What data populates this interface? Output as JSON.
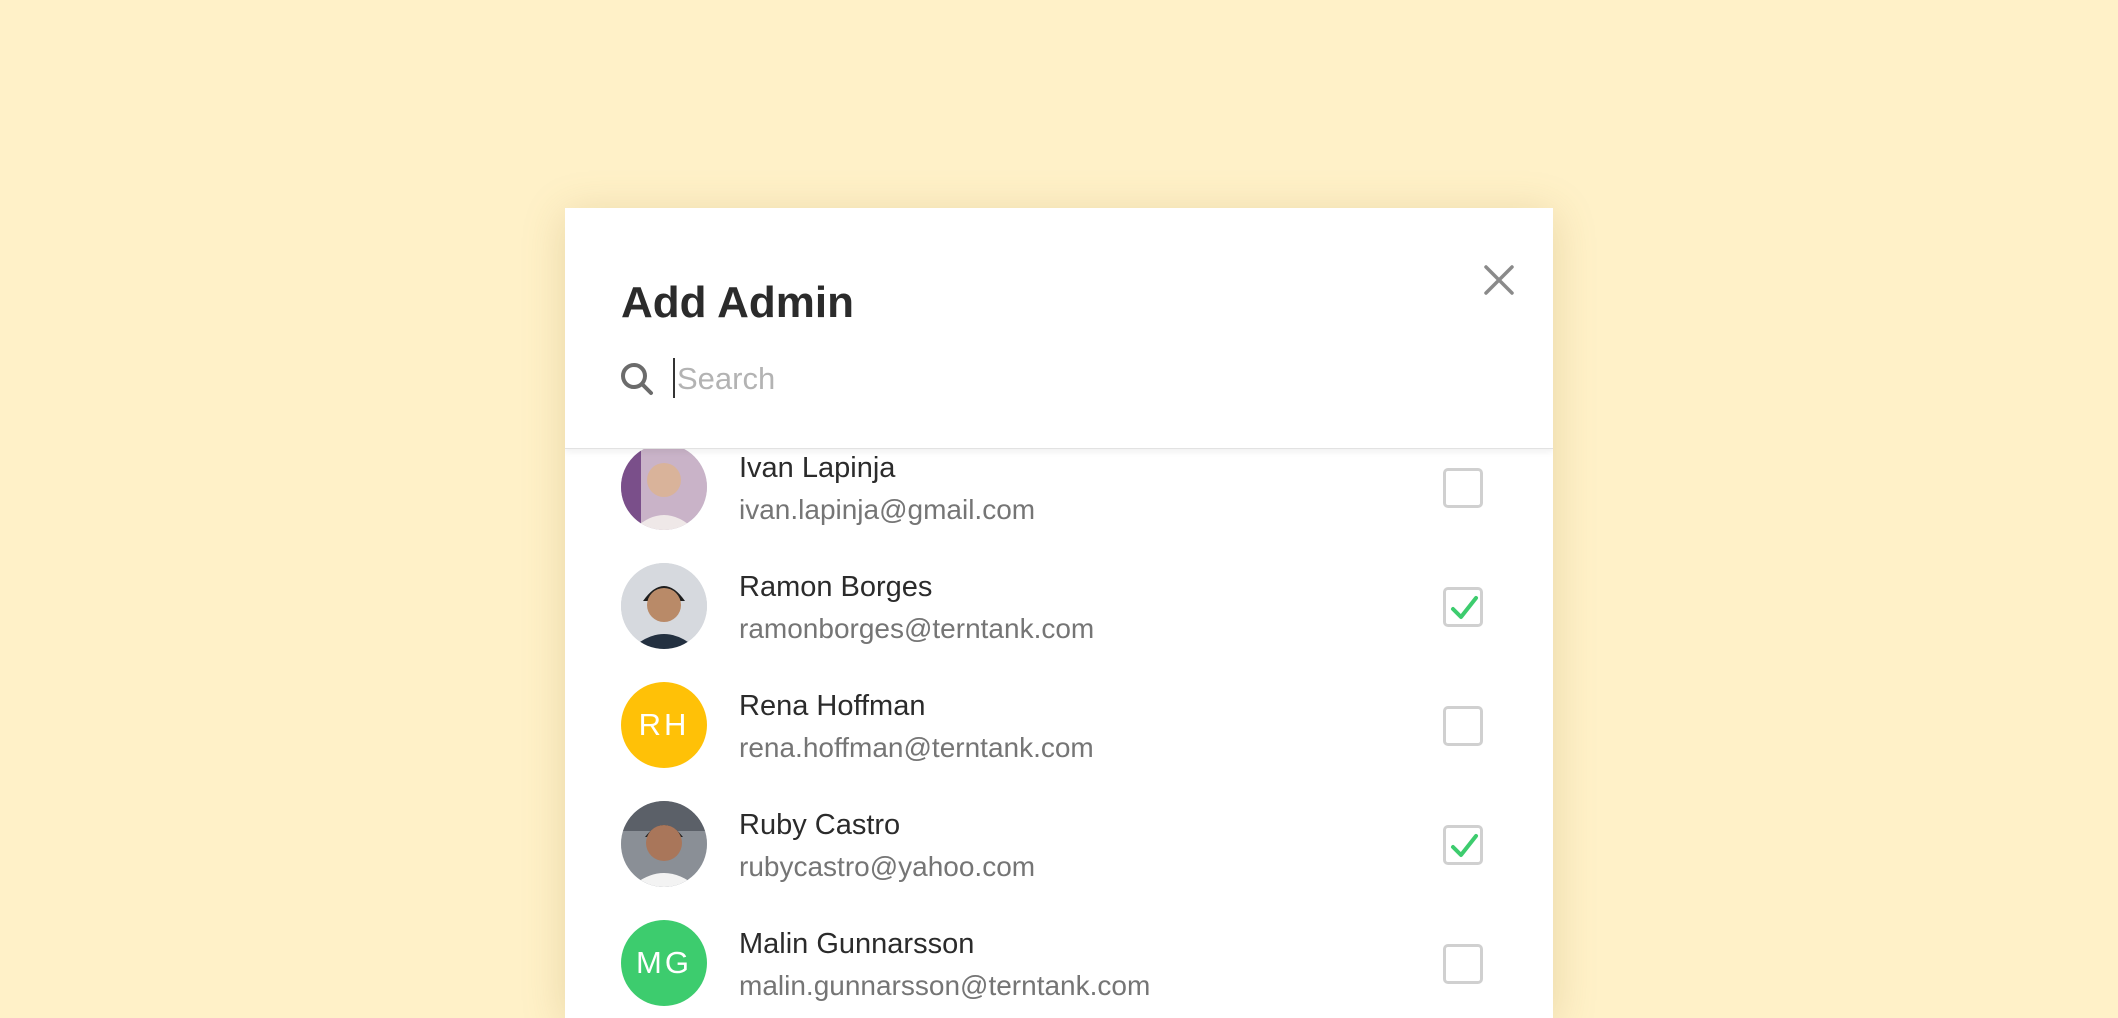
{
  "modal": {
    "title": "Add Admin",
    "close_icon": "close-icon"
  },
  "search": {
    "placeholder": "Search",
    "value": "",
    "icon": "search-icon"
  },
  "colors": {
    "background": "#FFF1C8",
    "check": "#3DCC6E",
    "avatar_yellow": "#FFC107",
    "avatar_green": "#3DCC6E"
  },
  "users": [
    {
      "name": "Ivan Lapinja",
      "email": "ivan.lapinja@gmail.com",
      "avatar": "photo",
      "checked": false
    },
    {
      "name": "Ramon Borges",
      "email": "ramonborges@terntank.com",
      "avatar": "photo",
      "checked": true
    },
    {
      "name": "Rena Hoffman",
      "email": "rena.hoffman@terntank.com",
      "avatar": "RH",
      "avatar_color": "#FFC107",
      "checked": false
    },
    {
      "name": "Ruby Castro",
      "email": "rubycastro@yahoo.com",
      "avatar": "photo",
      "checked": true
    },
    {
      "name": "Malin Gunnarsson",
      "email": "malin.gunnarsson@terntank.com",
      "avatar": "MG",
      "avatar_color": "#3DCC6E",
      "checked": false
    }
  ]
}
